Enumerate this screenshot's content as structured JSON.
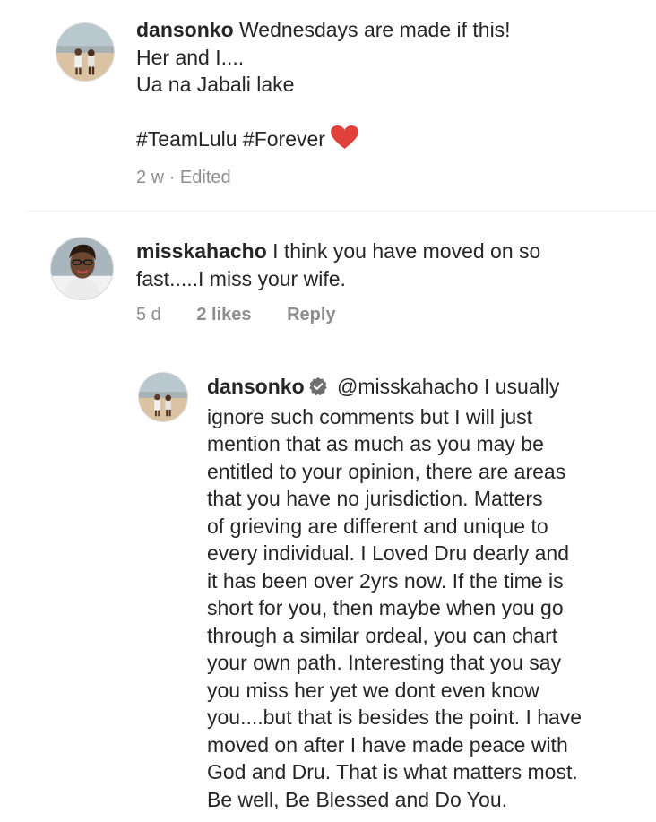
{
  "comments": [
    {
      "username": "dansonko",
      "lines": [
        "Wednesdays are made if this!",
        "Her and I....",
        "Ua na Jabali lake",
        "",
        "#TeamLulu #Forever"
      ],
      "emoji": "red-heart",
      "meta": {
        "time": "2 w",
        "separator": "·",
        "edited": "Edited"
      }
    },
    {
      "username": "misskahacho",
      "lines": [
        "I think you have moved on so",
        "fast.....I miss your wife."
      ],
      "meta": {
        "time": "5 d",
        "likes": "2 likes",
        "reply": "Reply"
      }
    }
  ],
  "reply": {
    "username": "dansonko",
    "verified": true,
    "mention": "@misskahacho",
    "first_line_rest": "I usually",
    "lines": [
      "ignore such comments but I will just",
      "mention that as much as you may be",
      "entitled to your opinion, there are areas",
      "that you have no jurisdiction. Matters",
      "of grieving are different and unique to",
      "every individual. I Loved Dru dearly and",
      "it has been over 2yrs now. If the time is",
      "short for you, then maybe when you go",
      "through a similar ordeal, you can chart",
      "your own path. Interesting that you say",
      "you miss her yet we dont even know",
      "you....but that is besides the point. I have",
      "moved on after I have made peace with",
      "God and Dru. That is what matters most.",
      "Be well, Be Blessed and Do You."
    ]
  },
  "colors": {
    "text": "#262626",
    "meta": "#8e8e8e",
    "heart": "#e0413a",
    "verified": "#6f6f6f"
  }
}
